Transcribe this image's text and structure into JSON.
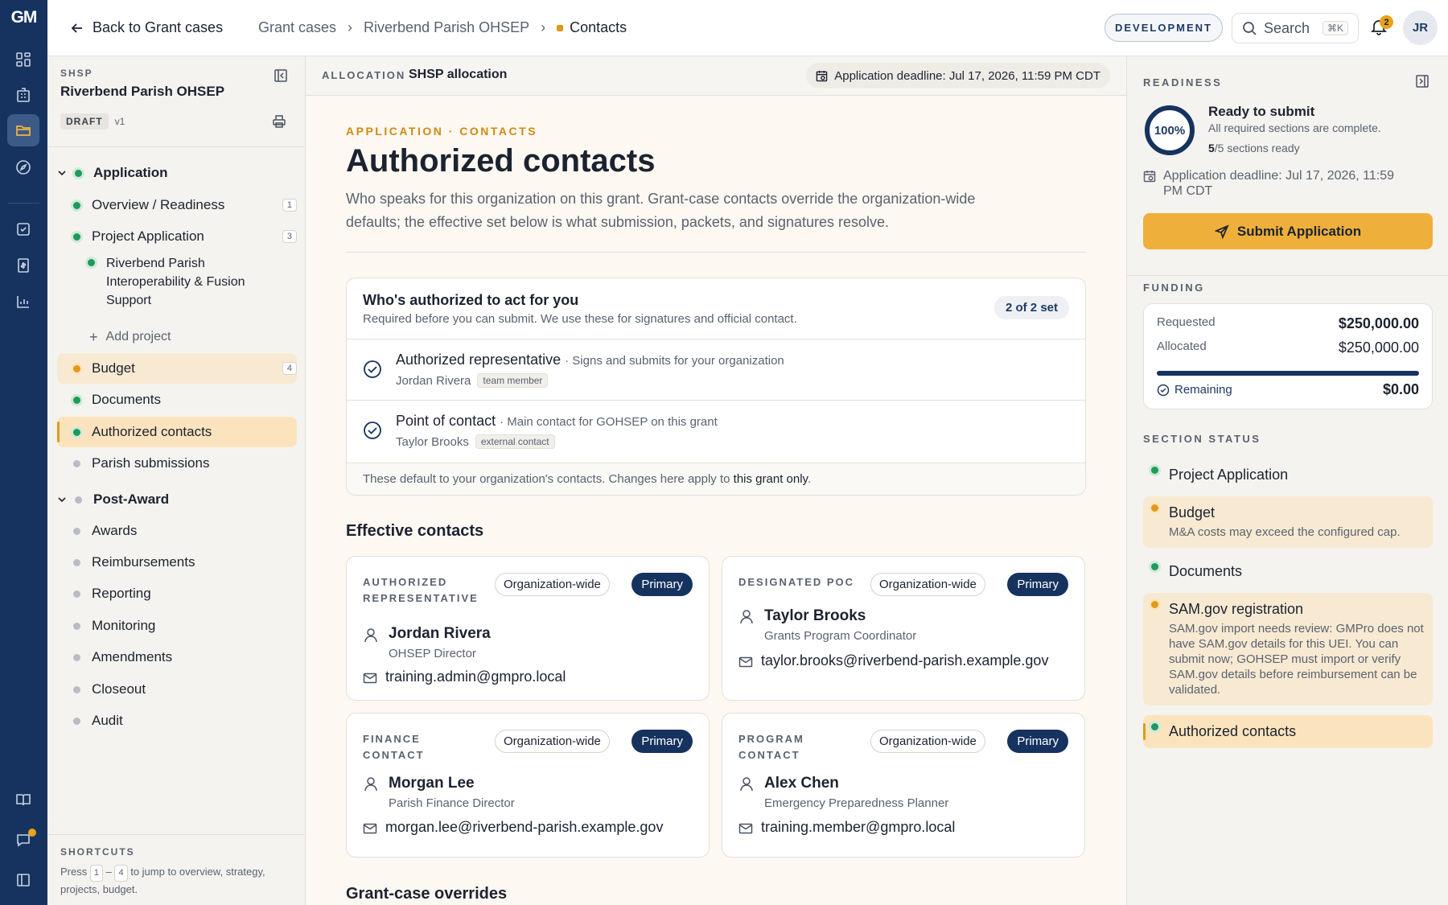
{
  "rail": {
    "logo": "GM",
    "badge_color": "#e8a317"
  },
  "topbar": {
    "back_label": "Back to Grant cases",
    "breadcrumbs": [
      "Grant cases",
      "Riverbend Parish OHSEP",
      "Contacts"
    ],
    "env_label": "DEVELOPMENT",
    "search_label": "Search",
    "search_shortcut": "⌘K",
    "notification_count": "2",
    "avatar_initials": "JR"
  },
  "sidebar": {
    "program_label": "SHSP",
    "org_name": "Riverbend Parish OHSEP",
    "status_badge": "DRAFT",
    "version": "v1",
    "application_group": "Application",
    "items": [
      {
        "label": "Overview / Readiness",
        "count": "1",
        "status": "green"
      },
      {
        "label": "Project Application",
        "count": "3",
        "status": "green"
      },
      {
        "label": "Riverbend Parish Interoperability & Fusion Support",
        "status": "green"
      },
      {
        "label": "Add project"
      },
      {
        "label": "Budget",
        "count": "4",
        "status": "orange"
      },
      {
        "label": "Documents",
        "status": "green"
      },
      {
        "label": "Authorized contacts",
        "status": "green"
      },
      {
        "label": "Parish submissions",
        "status": "gray"
      }
    ],
    "post_award_group": "Post-Award",
    "post_award_items": [
      "Awards",
      "Reimbursements",
      "Reporting",
      "Monitoring",
      "Amendments",
      "Closeout",
      "Audit"
    ],
    "shortcuts": {
      "title": "SHORTCUTS",
      "text_before": "Press",
      "key_start": "1",
      "key_sep": "–",
      "key_end": "4",
      "text_after": "to jump to overview, strategy, projects, budget."
    }
  },
  "main": {
    "allocation_label": "ALLOCATION",
    "allocation_value": "SHSP allocation",
    "deadline": "Application deadline: Jul 17, 2026, 11:59 PM CDT",
    "eyebrow": "APPLICATION · CONTACTS",
    "title": "Authorized contacts",
    "intro": "Who speaks for this organization on this grant. Grant-case contacts override the organization-wide defaults; the effective set below is what submission, packets, and signatures resolve.",
    "authorized": {
      "title": "Who's authorized to act for you",
      "subtitle": "Required before you can submit. We use these for signatures and official contact.",
      "status_pill": "2 of 2 set",
      "rows": [
        {
          "role": "Authorized representative",
          "desc": "· Signs and submits for your organization",
          "name": "Jordan Rivera",
          "tag": "team member"
        },
        {
          "role": "Point of contact",
          "desc": "· Main contact for GOHSEP on this grant",
          "name": "Taylor Brooks",
          "tag": "external contact"
        }
      ],
      "footer_before": "These default to your organization's contacts. Changes here apply to",
      "footer_strong": "this grant only",
      "footer_after": "."
    },
    "effective_title": "Effective contacts",
    "effective": [
      {
        "role": "AUTHORIZED REPRESENTATIVE",
        "scope": "Organization-wide",
        "badge": "Primary",
        "name": "Jordan Rivera",
        "title": "OHSEP Director",
        "email": "training.admin@gmpro.local"
      },
      {
        "role": "DESIGNATED POC",
        "scope": "Organization-wide",
        "badge": "Primary",
        "name": "Taylor Brooks",
        "title": "Grants Program Coordinator",
        "email": "taylor.brooks@riverbend-parish.example.gov"
      },
      {
        "role": "FINANCE CONTACT",
        "scope": "Organization-wide",
        "badge": "Primary",
        "name": "Morgan Lee",
        "title": "Parish Finance Director",
        "email": "morgan.lee@riverbend-parish.example.gov"
      },
      {
        "role": "PROGRAM CONTACT",
        "scope": "Organization-wide",
        "badge": "Primary",
        "name": "Alex Chen",
        "title": "Emergency Preparedness Planner",
        "email": "training.member@gmpro.local"
      }
    ],
    "overrides_title": "Grant-case overrides"
  },
  "right": {
    "readiness_label": "READINESS",
    "percent": "100%",
    "percent_value": 1.0,
    "ready_title": "Ready to submit",
    "ready_sub": "All required sections are complete.",
    "sections_done": "5",
    "sections_total": "/5 sections ready",
    "deadline": "Application deadline: Jul 17, 2026, 11:59 PM CDT",
    "submit_label": "Submit Application",
    "funding_label": "FUNDING",
    "requested_label": "Requested",
    "requested_value": "$250,000.00",
    "allocated_label": "Allocated",
    "allocated_value": "$250,000.00",
    "allocated_fraction": 1.0,
    "remaining_label": "Remaining",
    "remaining_value": "$0.00",
    "section_status_label": "SECTION STATUS",
    "sections": [
      {
        "title": "Project Application",
        "status": "green"
      },
      {
        "title": "Budget",
        "note": "M&A costs may exceed the configured cap.",
        "status": "orange"
      },
      {
        "title": "Documents",
        "status": "green"
      },
      {
        "title": "SAM.gov registration",
        "note": "SAM.gov import needs review: GMPro does not have SAM.gov details for this UEI. You can submit now; GOHSEP must import or verify SAM.gov details before reimbursement can be validated.",
        "status": "orange"
      },
      {
        "title": "Authorized contacts",
        "status": "green"
      }
    ]
  },
  "colors": {
    "navy": "#16335f",
    "accent": "#e39a16",
    "green": "#1e9a5b",
    "submit": "#eeb03a"
  }
}
